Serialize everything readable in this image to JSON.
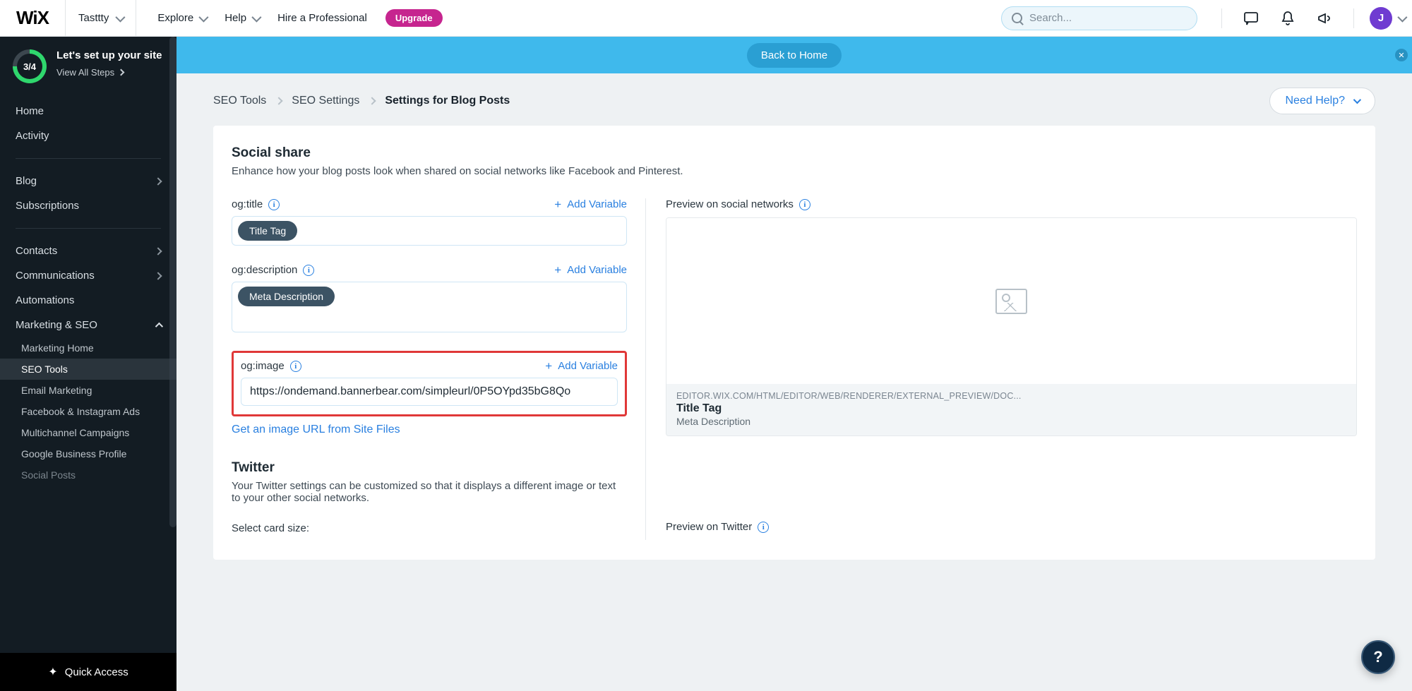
{
  "top": {
    "logo_text": "WiX",
    "site_name": "Tasttty",
    "nav": {
      "explore": "Explore",
      "help": "Help",
      "hire": "Hire a Professional"
    },
    "upgrade": "Upgrade",
    "search_placeholder": "Search...",
    "avatar_initial": "J"
  },
  "setup": {
    "progress": "3/4",
    "title": "Let's set up your site",
    "link": "View All Steps"
  },
  "sidebar": {
    "home": "Home",
    "activity": "Activity",
    "blog": "Blog",
    "subscriptions": "Subscriptions",
    "contacts": "Contacts",
    "communications": "Communications",
    "automations": "Automations",
    "marketing_seo": "Marketing & SEO",
    "subs": {
      "marketing_home": "Marketing Home",
      "seo_tools": "SEO Tools",
      "email_marketing": "Email Marketing",
      "fb_insta": "Facebook & Instagram Ads",
      "multichannel": "Multichannel Campaigns",
      "google_biz": "Google Business Profile",
      "social_posts": "Social Posts"
    },
    "quick_access": "Quick Access"
  },
  "banner": {
    "back": "Back to Home"
  },
  "breadcrumbs": {
    "a": "SEO Tools",
    "b": "SEO Settings",
    "c": "Settings for Blog Posts"
  },
  "help_btn": "Need Help?",
  "social": {
    "heading": "Social share",
    "sub": "Enhance how your blog posts look when shared on social networks like Facebook and Pinterest.",
    "og_title_label": "og:title",
    "og_title_tag": "Title Tag",
    "og_desc_label": "og:description",
    "og_desc_tag": "Meta Description",
    "og_image_label": "og:image",
    "og_image_value": "https://ondemand.bannerbear.com/simpleurl/0P5OYpd35bG8Qo",
    "add_variable": "Add Variable",
    "get_image_url": "Get an image URL from Site Files"
  },
  "preview": {
    "label": "Preview on social networks",
    "url": "EDITOR.WIX.COM/HTML/EDITOR/WEB/RENDERER/EXTERNAL_PREVIEW/DOC...",
    "title": "Title Tag",
    "desc": "Meta Description"
  },
  "twitter": {
    "heading": "Twitter",
    "sub": "Your Twitter settings can be customized so that it displays a different image or text to your other social networks.",
    "select_card": "Select card size:",
    "preview_label": "Preview on Twitter"
  },
  "fab": "?"
}
